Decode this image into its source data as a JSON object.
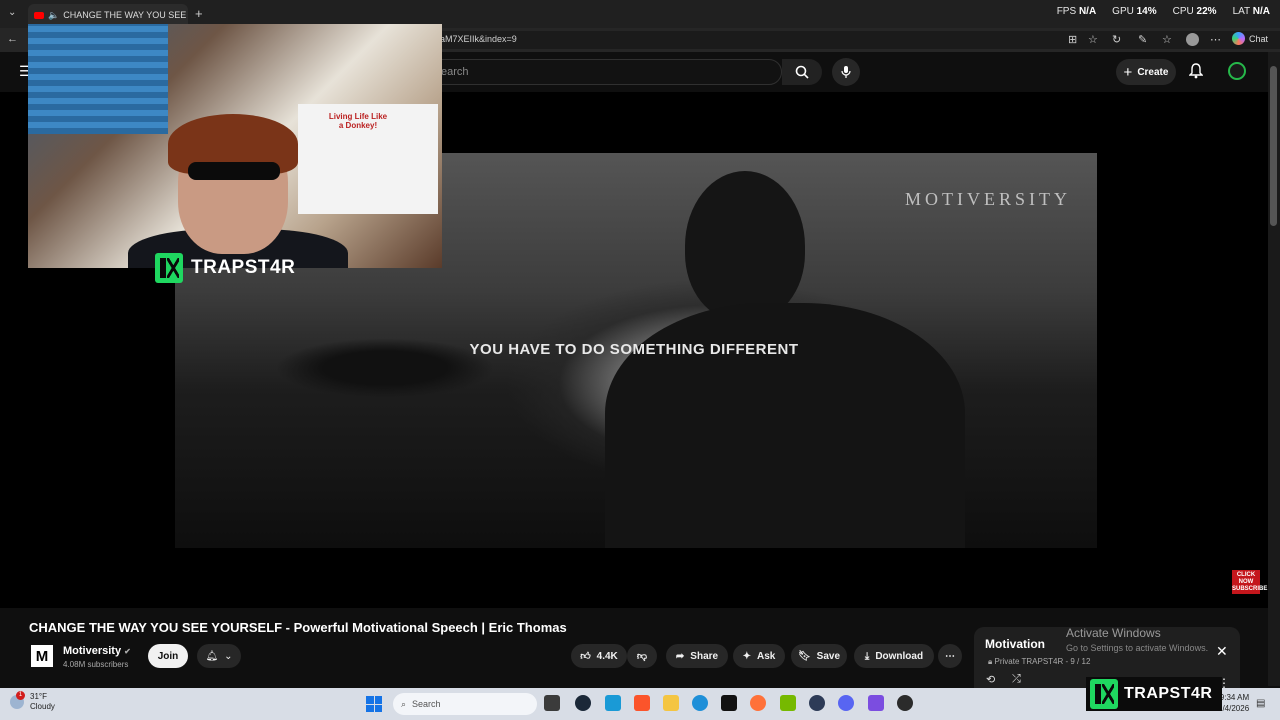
{
  "browser": {
    "tab_title": "CHANGE THE WAY YOU SEE YOURSELF",
    "url": "aM7XEIIk&index=9",
    "chat_label": "Chat"
  },
  "stats": {
    "fps_label": "FPS",
    "fps_value": "N/A",
    "gpu_label": "GPU",
    "gpu_value": "14%",
    "cpu_label": "CPU",
    "cpu_value": "22%",
    "lat_label": "LAT",
    "lat_value": "N/A"
  },
  "youtube": {
    "search_placeholder": "earch",
    "create_label": "Create"
  },
  "video": {
    "watermark": "MOTIVERSITY",
    "subtitle": "YOU HAVE TO DO SOMETHING DIFFERENT",
    "subscribe_badge": "CLICK NOW SUBSCRIBE",
    "title": "CHANGE THE WAY YOU SEE YOURSELF - Powerful Motivational Speech | Eric Thomas"
  },
  "overlay": {
    "streamer_tag": "TRAPST4R",
    "poster_text": "Living Life Like a Donkey!"
  },
  "channel": {
    "avatar_letter": "M",
    "name": "Motiversity",
    "subscribers": "4.08M subscribers",
    "join_label": "Join"
  },
  "actions": {
    "likes": "4.4K",
    "share": "Share",
    "ask": "Ask",
    "save": "Save",
    "download": "Download"
  },
  "playlist": {
    "title": "Motivation",
    "meta": "Private TRAPST4R - 9 / 12"
  },
  "windows_watermark": {
    "title": "Activate Windows",
    "subtitle": "Go to Settings to activate Windows."
  },
  "taskbar": {
    "weather_badge": "1",
    "temperature": "31°F",
    "condition": "Cloudy",
    "search_label": "Search",
    "time": "9:34 AM",
    "date": "2/4/2026"
  },
  "colors": {
    "youtube_red": "#ff0000",
    "streamer_green": "#1fd760",
    "taskbar": "#d8dde6"
  }
}
